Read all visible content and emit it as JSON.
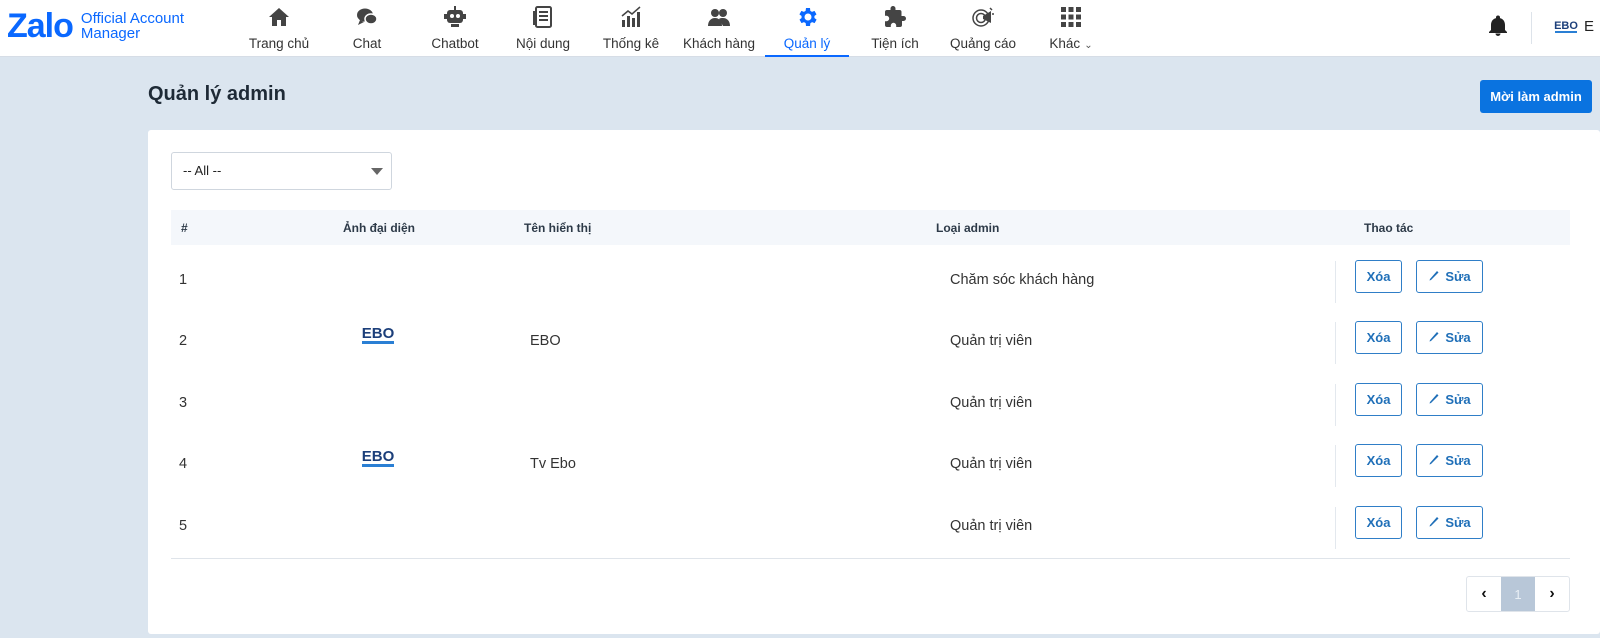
{
  "brand": {
    "name": "Zalo",
    "subtitle_line1": "Official Account",
    "subtitle_line2": "Manager",
    "color": "#0a68ff"
  },
  "nav": {
    "items": [
      {
        "label": "Trang chủ",
        "icon": "home-icon"
      },
      {
        "label": "Chat",
        "icon": "chat-icon"
      },
      {
        "label": "Chatbot",
        "icon": "robot-icon"
      },
      {
        "label": "Nội dung",
        "icon": "document-icon"
      },
      {
        "label": "Thống kê",
        "icon": "bar-chart-icon"
      },
      {
        "label": "Khách hàng",
        "icon": "users-icon"
      },
      {
        "label": "Quản lý",
        "icon": "gear-icon",
        "active": true
      },
      {
        "label": "Tiện ích",
        "icon": "puzzle-icon"
      },
      {
        "label": "Quảng cáo",
        "icon": "megaphone-icon"
      },
      {
        "label": "Khác",
        "icon": "grid-icon",
        "has_dropdown": true
      }
    ]
  },
  "account": {
    "name": "E",
    "logo_text": "EBO"
  },
  "page": {
    "title": "Quản lý admin",
    "invite_label": "Mời làm admin"
  },
  "filter": {
    "selected": "-- All --"
  },
  "table": {
    "headers": {
      "index": "#",
      "avatar": "Ảnh đại diện",
      "name": "Tên hiển thị",
      "type": "Loại admin",
      "actions": "Thao tác"
    },
    "delete_label": "Xóa",
    "edit_label": "Sửa",
    "rows": [
      {
        "index": "1",
        "name": "",
        "type": "Chăm sóc khách hàng",
        "avatar": ""
      },
      {
        "index": "2",
        "name": "EBO",
        "type": "Quản trị viên",
        "avatar": "EBO"
      },
      {
        "index": "3",
        "name": "",
        "type": "Quản trị viên",
        "avatar": ""
      },
      {
        "index": "4",
        "name": "Tv Ebo",
        "type": "Quản trị viên",
        "avatar": "EBO"
      },
      {
        "index": "5",
        "name": "",
        "type": "Quản trị viên",
        "avatar": ""
      }
    ]
  },
  "pagination": {
    "prev": "‹",
    "current": "1",
    "next": "›"
  },
  "colors": {
    "accent": "#0a68ff",
    "primary_button": "#0a73e0",
    "page_bg": "#dbe5ef"
  }
}
